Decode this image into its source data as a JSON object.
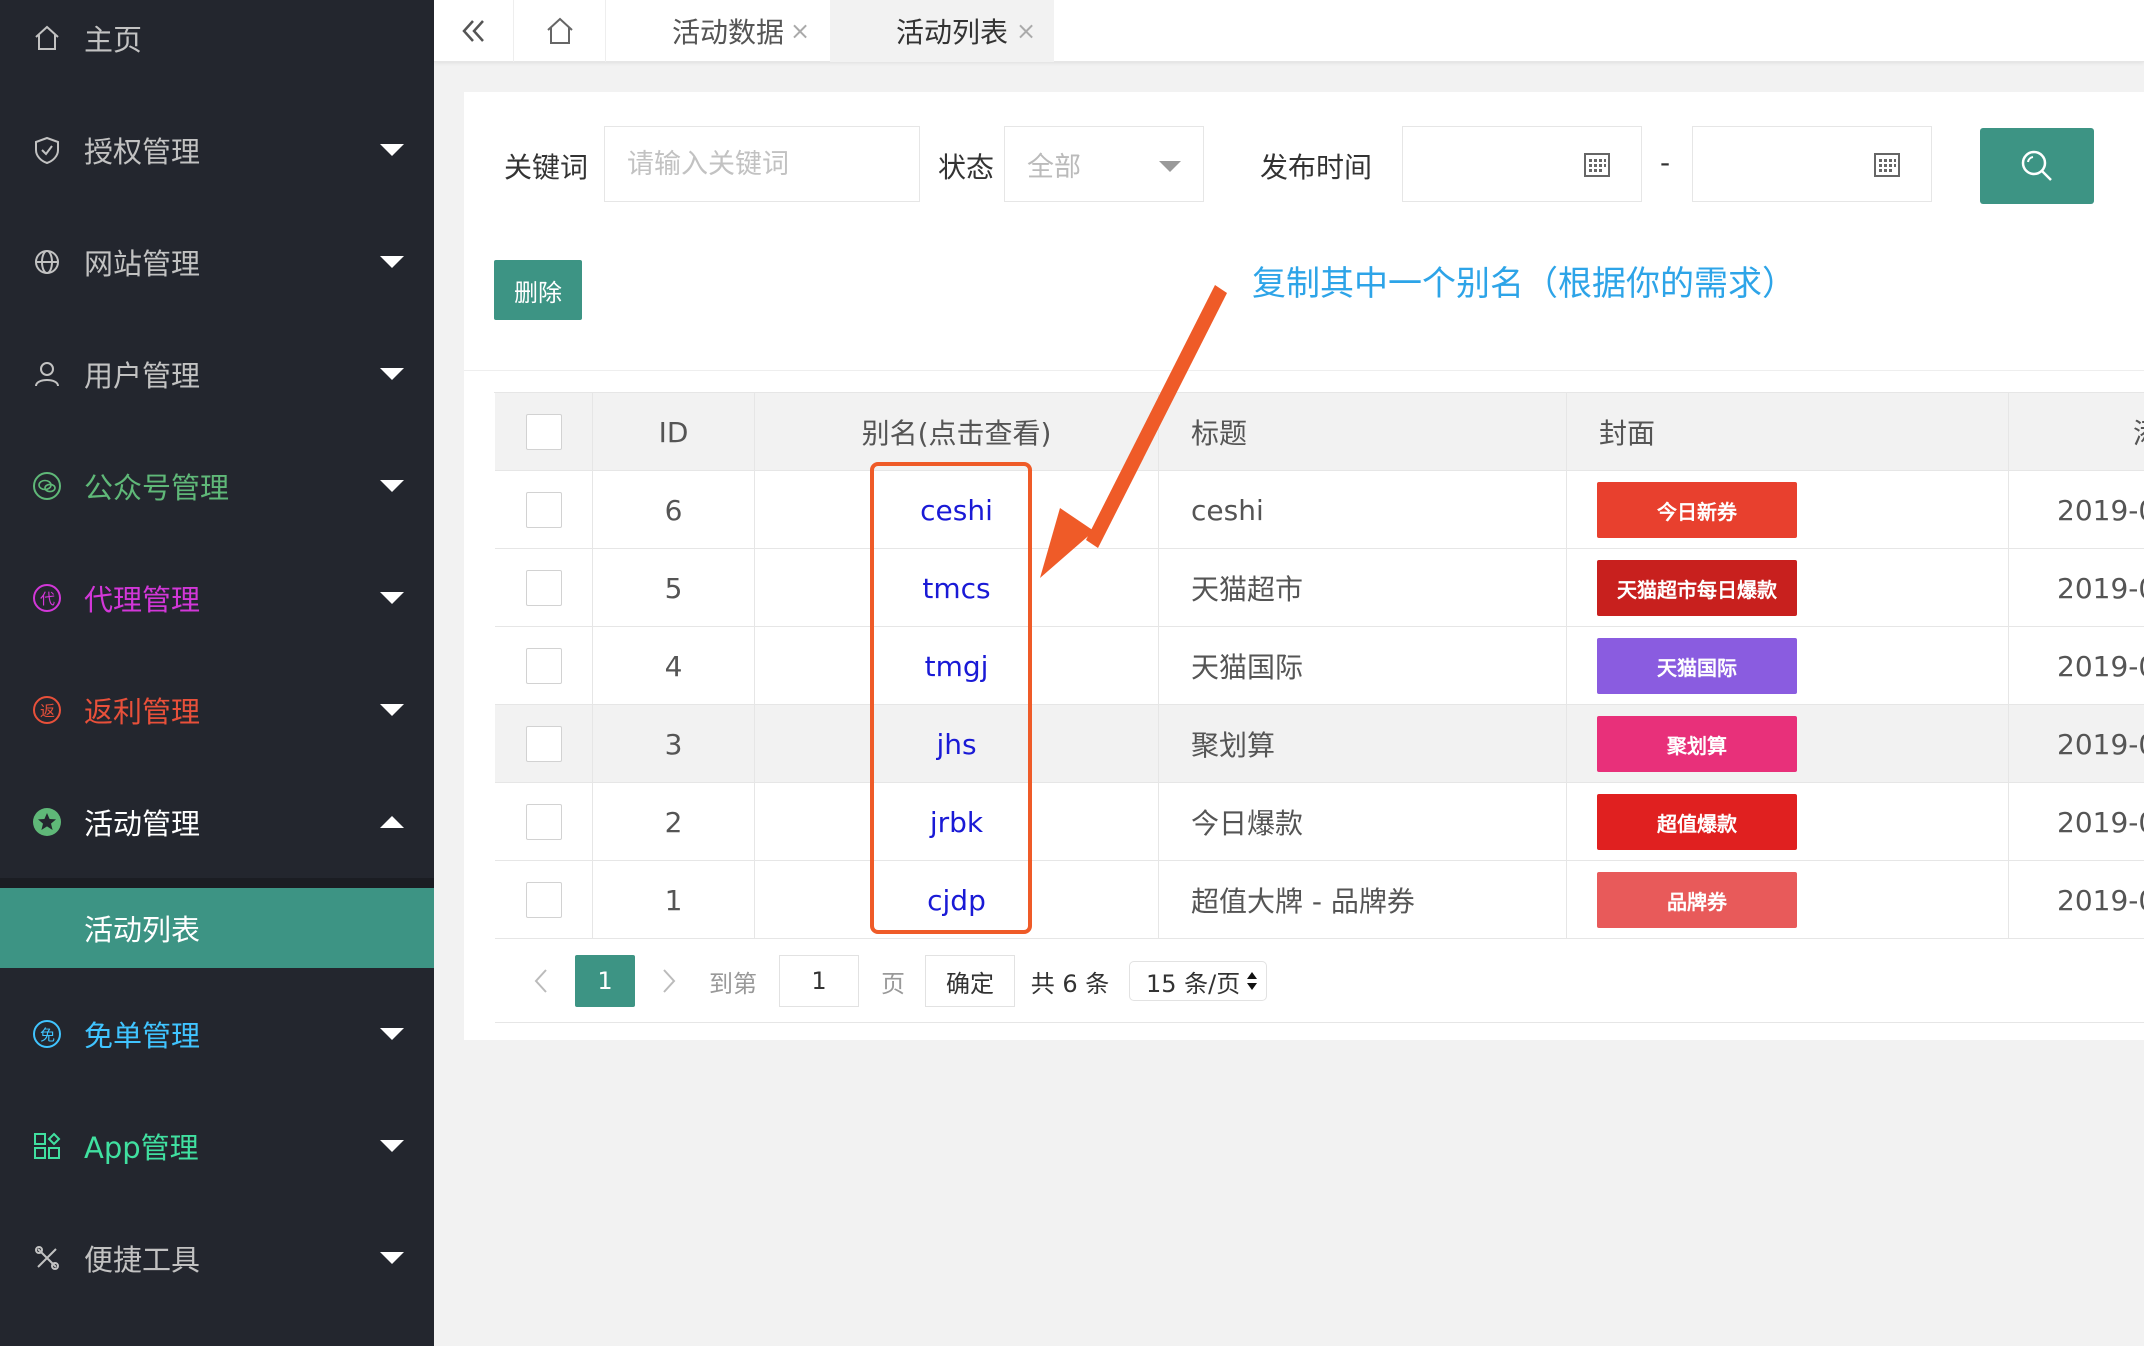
{
  "sidebar": {
    "items": [
      {
        "label": "主页",
        "icon": "home-icon",
        "color": "#c2c2c2",
        "caret": "none"
      },
      {
        "label": "授权管理",
        "icon": "shield-icon",
        "color": "#c2c2c2",
        "caret": "down"
      },
      {
        "label": "网站管理",
        "icon": "globe-icon",
        "color": "#c2c2c2",
        "caret": "down"
      },
      {
        "label": "用户管理",
        "icon": "user-icon",
        "color": "#c2c2c2",
        "caret": "down"
      },
      {
        "label": "公众号管理",
        "icon": "wechat-icon",
        "color": "#5fb878",
        "caret": "down"
      },
      {
        "label": "代理管理",
        "icon": "agent-icon",
        "color": "#d237d8",
        "caret": "down"
      },
      {
        "label": "返利管理",
        "icon": "rebate-icon",
        "color": "#e8503a",
        "caret": "down"
      },
      {
        "label": "活动管理",
        "icon": "star-icon",
        "color": "#ffffff",
        "caret": "up"
      },
      {
        "label": "免单管理",
        "icon": "free-icon",
        "color": "#40c4ff",
        "caret": "down"
      },
      {
        "label": "App管理",
        "icon": "apps-icon",
        "color": "#40e0a0",
        "caret": "down"
      },
      {
        "label": "便捷工具",
        "icon": "tools-icon",
        "color": "#c2c2c2",
        "caret": "down"
      }
    ],
    "sub_item": "活动列表"
  },
  "tabs": [
    {
      "label": "活动数据"
    },
    {
      "label": "活动列表"
    }
  ],
  "filters": {
    "keyword_label": "关键词",
    "keyword_placeholder": "请输入关键词",
    "status_label": "状态",
    "status_value": "全部",
    "time_label": "发布时间",
    "time_sep": "-"
  },
  "delete_label": "删除",
  "annotation": "复制其中一个别名（根据你的需求）",
  "table": {
    "headers": [
      "ID",
      "别名(点击查看)",
      "标题",
      "封面",
      "添"
    ],
    "rows": [
      {
        "id": "6",
        "alias": "ceshi",
        "title": "ceshi",
        "cover_text": "今日新券",
        "cover_color": "#e8402e",
        "date": "2019-0"
      },
      {
        "id": "5",
        "alias": "tmcs",
        "title": "天猫超市",
        "cover_text": "天猫超市每日爆款",
        "cover_color": "#c8201e",
        "date": "2019-0"
      },
      {
        "id": "4",
        "alias": "tmgj",
        "title": "天猫国际",
        "cover_text": "天猫国际",
        "cover_color": "#8a5ce0",
        "date": "2019-0"
      },
      {
        "id": "3",
        "alias": "jhs",
        "title": "聚划算",
        "cover_text": "聚划算",
        "cover_color": "#e8307a",
        "date": "2019-0"
      },
      {
        "id": "2",
        "alias": "jrbk",
        "title": "今日爆款",
        "cover_text": "超值爆款",
        "cover_color": "#e02020",
        "date": "2019-0"
      },
      {
        "id": "1",
        "alias": "cjdp",
        "title": "超值大牌 - 品牌券",
        "cover_text": "品牌券",
        "cover_color": "#e85a5a",
        "date": "2019-0"
      }
    ]
  },
  "pagination": {
    "current": "1",
    "goto_label": "到第",
    "goto_value": "1",
    "page_label": "页",
    "confirm_label": "确定",
    "total_label": "共 6 条",
    "per_page": "15 条/页"
  },
  "colors": {
    "accent": "#3d9484",
    "sidebar": "#23262e",
    "annotation": "#2da4e8",
    "highlight_box": "#ef5b28"
  }
}
